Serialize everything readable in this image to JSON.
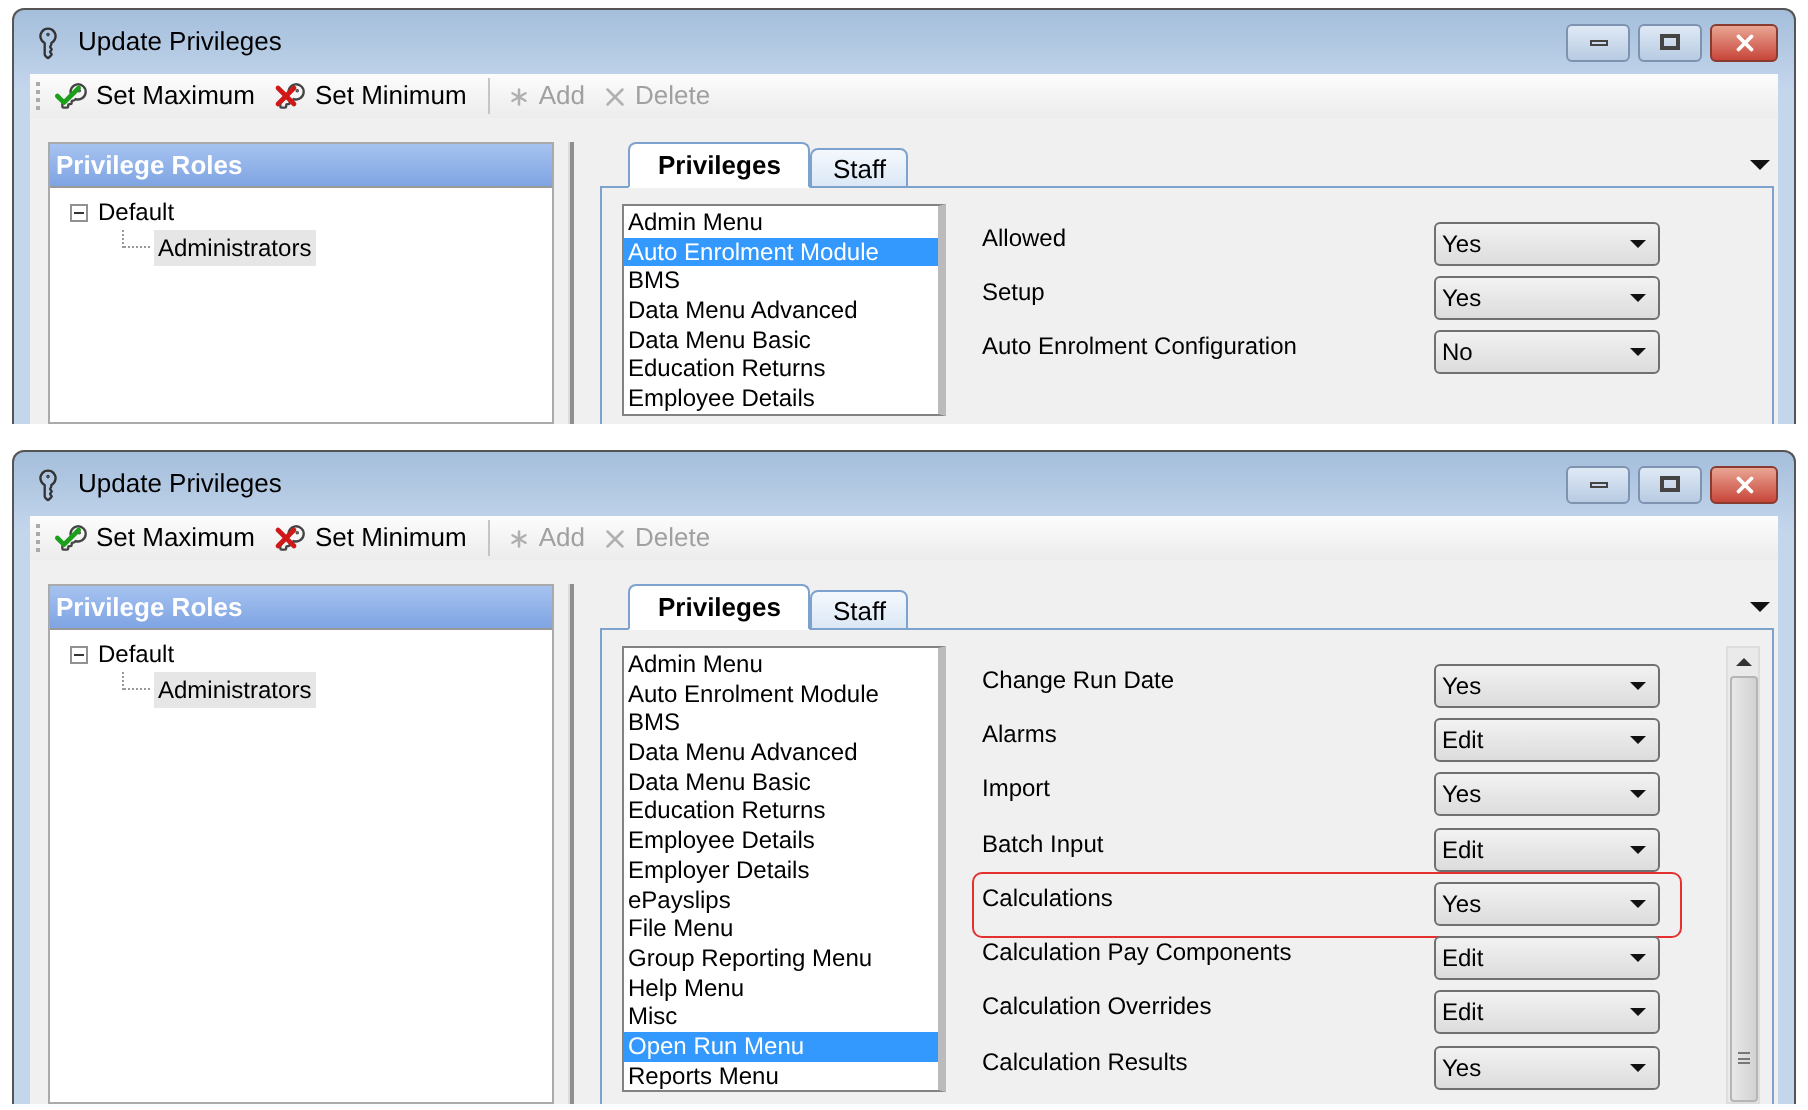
{
  "windows": [
    {
      "title": "Update Privileges",
      "toolbar": {
        "groups": [
          [
            {
              "kind": "maximum",
              "label": "Set Maximum",
              "disabled": false
            },
            {
              "kind": "minimum",
              "label": "Set Minimum",
              "disabled": false
            }
          ],
          [
            {
              "kind": "add",
              "label": "Add",
              "disabled": true
            },
            {
              "kind": "delete",
              "label": "Delete",
              "disabled": true
            }
          ]
        ]
      },
      "roles_panel": {
        "title": "Privilege Roles",
        "tree": [
          {
            "label": "Default",
            "expanded": true,
            "selected": false,
            "children": [
              {
                "label": "Administrators",
                "selected": true
              }
            ]
          }
        ]
      },
      "tabs": [
        {
          "label": "Privileges",
          "selected": true
        },
        {
          "label": "Staff",
          "selected": false
        }
      ],
      "modules": [
        {
          "label": "Admin Menu",
          "selected": false
        },
        {
          "label": "Auto Enrolment Module",
          "selected": true
        },
        {
          "label": "BMS",
          "selected": false
        },
        {
          "label": "Data Menu Advanced",
          "selected": false
        },
        {
          "label": "Data Menu Basic",
          "selected": false
        },
        {
          "label": "Education Returns",
          "selected": false
        },
        {
          "label": "Employee Details",
          "selected": false
        }
      ],
      "privileges": [
        {
          "label": "Allowed",
          "value": "Yes",
          "highlighted": false
        },
        {
          "label": "Setup",
          "value": "Yes",
          "highlighted": false
        },
        {
          "label": "Auto Enrolment Configuration",
          "value": "No",
          "highlighted": false
        }
      ],
      "scrollbar": false
    },
    {
      "title": "Update Privileges",
      "toolbar": {
        "groups": [
          [
            {
              "kind": "maximum",
              "label": "Set Maximum",
              "disabled": false
            },
            {
              "kind": "minimum",
              "label": "Set Minimum",
              "disabled": false
            }
          ],
          [
            {
              "kind": "add",
              "label": "Add",
              "disabled": true
            },
            {
              "kind": "delete",
              "label": "Delete",
              "disabled": true
            }
          ]
        ]
      },
      "roles_panel": {
        "title": "Privilege Roles",
        "tree": [
          {
            "label": "Default",
            "expanded": true,
            "selected": false,
            "children": [
              {
                "label": "Administrators",
                "selected": true
              }
            ]
          }
        ]
      },
      "tabs": [
        {
          "label": "Privileges",
          "selected": true
        },
        {
          "label": "Staff",
          "selected": false
        }
      ],
      "modules": [
        {
          "label": "Admin Menu",
          "selected": false
        },
        {
          "label": "Auto Enrolment Module",
          "selected": false
        },
        {
          "label": "BMS",
          "selected": false
        },
        {
          "label": "Data Menu Advanced",
          "selected": false
        },
        {
          "label": "Data Menu Basic",
          "selected": false
        },
        {
          "label": "Education Returns",
          "selected": false
        },
        {
          "label": "Employee Details",
          "selected": false
        },
        {
          "label": "Employer Details",
          "selected": false
        },
        {
          "label": "ePayslips",
          "selected": false
        },
        {
          "label": "File Menu",
          "selected": false
        },
        {
          "label": "Group Reporting Menu",
          "selected": false
        },
        {
          "label": "Help Menu",
          "selected": false
        },
        {
          "label": "Misc",
          "selected": false
        },
        {
          "label": "Open Run Menu",
          "selected": true
        },
        {
          "label": "Reports Menu",
          "selected": false
        }
      ],
      "privileges": [
        {
          "label": "Change Run Date",
          "value": "Yes",
          "highlighted": false
        },
        {
          "label": "Alarms",
          "value": "Edit",
          "highlighted": false
        },
        {
          "label": "Import",
          "value": "Yes",
          "highlighted": false
        },
        {
          "label": "Batch Input",
          "value": "Edit",
          "highlighted": false
        },
        {
          "label": "Calculations",
          "value": "Yes",
          "highlighted": true
        },
        {
          "label": "Calculation Pay Components",
          "value": "Edit",
          "highlighted": false
        },
        {
          "label": "Calculation Overrides",
          "value": "Edit",
          "highlighted": false
        },
        {
          "label": "Calculation Results",
          "value": "Yes",
          "highlighted": false
        }
      ],
      "scrollbar": true
    }
  ]
}
